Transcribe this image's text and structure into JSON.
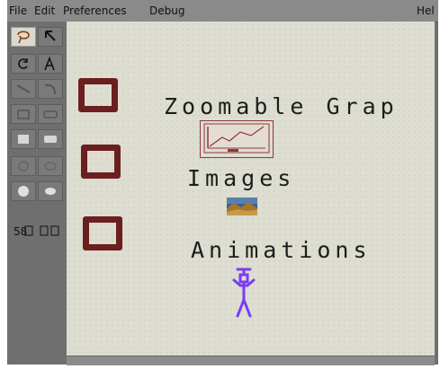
{
  "menu": {
    "file": "File",
    "edit": "Edit",
    "preferences": "Preferences",
    "debug": "Debug",
    "help": "Hel"
  },
  "labels": {
    "zoomable": "Zoomable Grap",
    "images": "Images",
    "animations": "Animations"
  },
  "colors": {
    "rect_border": "#6b1f1f",
    "canvas_bg": "#ddddd2",
    "stick_figure": "#7a3cf0"
  },
  "icons": [
    "lasso-icon",
    "pointer-icon",
    "rotate-icon",
    "text-icon",
    "line-icon",
    "curve-icon",
    "rect-icon",
    "rounded-rect-icon",
    "filled-rect-icon",
    "filled-rounded-rect-icon",
    "ellipse-icon",
    "circle-icon",
    "filled-circle-icon",
    "filled-ellipse-icon",
    "group-icon",
    "ungroup-icon"
  ]
}
